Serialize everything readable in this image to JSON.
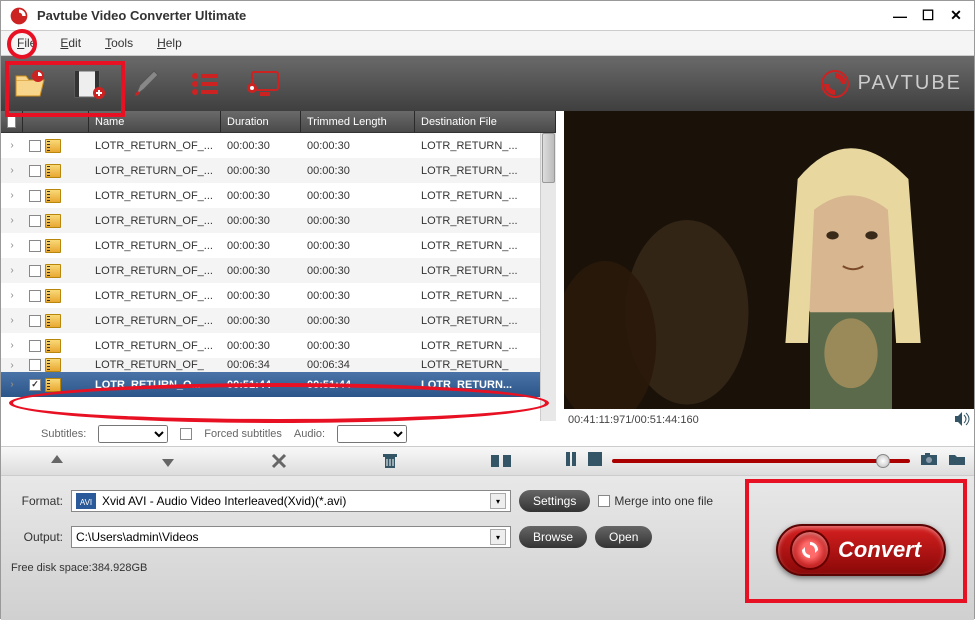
{
  "title": "Pavtube Video Converter Ultimate",
  "brand": "PAVTUBE",
  "menu": {
    "file": "File",
    "edit": "Edit",
    "tools": "Tools",
    "help": "Help"
  },
  "columns": {
    "name": "Name",
    "duration": "Duration",
    "trimmed": "Trimmed Length",
    "dest": "Destination File"
  },
  "rows": [
    {
      "name": "LOTR_RETURN_OF_...",
      "dur": "00:00:30",
      "trim": "00:00:30",
      "dest": "LOTR_RETURN_..."
    },
    {
      "name": "LOTR_RETURN_OF_...",
      "dur": "00:00:30",
      "trim": "00:00:30",
      "dest": "LOTR_RETURN_..."
    },
    {
      "name": "LOTR_RETURN_OF_...",
      "dur": "00:00:30",
      "trim": "00:00:30",
      "dest": "LOTR_RETURN_..."
    },
    {
      "name": "LOTR_RETURN_OF_...",
      "dur": "00:00:30",
      "trim": "00:00:30",
      "dest": "LOTR_RETURN_..."
    },
    {
      "name": "LOTR_RETURN_OF_...",
      "dur": "00:00:30",
      "trim": "00:00:30",
      "dest": "LOTR_RETURN_..."
    },
    {
      "name": "LOTR_RETURN_OF_...",
      "dur": "00:00:30",
      "trim": "00:00:30",
      "dest": "LOTR_RETURN_..."
    },
    {
      "name": "LOTR_RETURN_OF_...",
      "dur": "00:00:30",
      "trim": "00:00:30",
      "dest": "LOTR_RETURN_..."
    },
    {
      "name": "LOTR_RETURN_OF_...",
      "dur": "00:00:30",
      "trim": "00:00:30",
      "dest": "LOTR_RETURN_..."
    },
    {
      "name": "LOTR_RETURN_OF_...",
      "dur": "00:00:30",
      "trim": "00:00:30",
      "dest": "LOTR_RETURN_..."
    }
  ],
  "selrow": {
    "name": "LOTR_RETURN_O...",
    "dur": "00:51:44",
    "trim": "00:51:44",
    "dest": "LOTR_RETURN..."
  },
  "hiddenrow": {
    "name": "LOTR_RETURN_OF_",
    "dur": "00:06:34",
    "trim": "00:06:34",
    "dest": "LOTR_RETURN_"
  },
  "sub": {
    "subtitles": "Subtitles:",
    "forced": "Forced subtitles",
    "audio": "Audio:"
  },
  "time": "00:41:11:971/00:51:44:160",
  "format": {
    "label": "Format:",
    "value": "Xvid AVI - Audio Video Interleaved(Xvid)(*.avi)"
  },
  "output": {
    "label": "Output:",
    "value": "C:\\Users\\admin\\Videos"
  },
  "buttons": {
    "settings": "Settings",
    "browse": "Browse",
    "open": "Open",
    "convert": "Convert"
  },
  "merge": "Merge into one file",
  "freedisk": "Free disk space:384.928GB"
}
